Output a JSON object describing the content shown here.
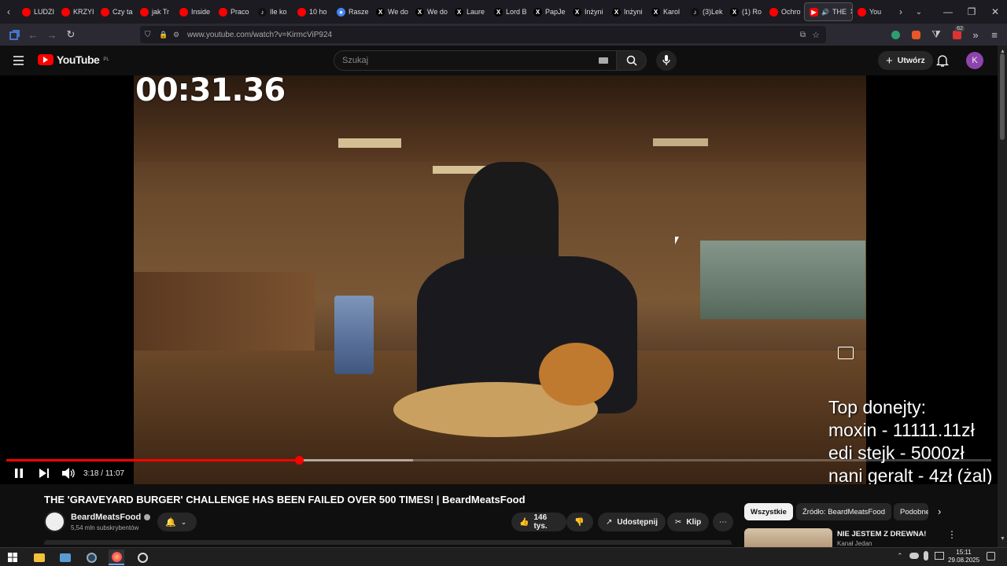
{
  "browser": {
    "tabs": [
      {
        "label": "LUDZI",
        "favicon": "youtube"
      },
      {
        "label": "KRZYI",
        "favicon": "youtube"
      },
      {
        "label": "Czy ta",
        "favicon": "youtube"
      },
      {
        "label": "jak Tr",
        "favicon": "youtube"
      },
      {
        "label": "Inside",
        "favicon": "youtube"
      },
      {
        "label": "Praco",
        "favicon": "youtube"
      },
      {
        "label": "Ile ko",
        "favicon": "tiktok"
      },
      {
        "label": "10 ho",
        "favicon": "youtube"
      },
      {
        "label": "Rasze",
        "favicon": "google"
      },
      {
        "label": "We do",
        "favicon": "x"
      },
      {
        "label": "We do",
        "favicon": "x"
      },
      {
        "label": "Laure",
        "favicon": "x"
      },
      {
        "label": "Lord B",
        "favicon": "x"
      },
      {
        "label": "PapJe",
        "favicon": "x"
      },
      {
        "label": "Inżyni",
        "favicon": "x"
      },
      {
        "label": "Inżyni",
        "favicon": "x"
      },
      {
        "label": "Karol",
        "favicon": "x"
      },
      {
        "label": "(3)Lek",
        "favicon": "tiktok"
      },
      {
        "label": "(1) Ro",
        "favicon": "x"
      },
      {
        "label": "Ochro",
        "favicon": "youtube"
      }
    ],
    "active_tab": {
      "label": "THE",
      "favicon": "youtube"
    },
    "next_tab": {
      "label": "You",
      "favicon": "youtube"
    },
    "url": "www.youtube.com/watch?v=KirmcViP924",
    "extension_badge": "62"
  },
  "youtube": {
    "logo_text": "YouTube",
    "region": "PL",
    "search_placeholder": "Szukaj",
    "create_label": "Utwórz",
    "avatar_letter": "K"
  },
  "player": {
    "overlay_timer": "00:31.36",
    "donors": [
      "Top donejty:",
      "moxin - 11111.11zł",
      "edi stejk - 5000zł",
      "nani geralt - 4zł (żal)"
    ],
    "time_current": "3:18",
    "time_separator": "/",
    "time_total": "11:07",
    "progress_fraction": 0.297,
    "buffered_fraction": 0.413
  },
  "video": {
    "title": "THE 'GRAVEYARD BURGER' CHALLENGE HAS BEEN FAILED OVER 500 TIMES! | BeardMeatsFood",
    "channel": "BeardMeatsFood",
    "subscribers": "5,54 mln subskrybentów",
    "likes": "146 tys.",
    "share_label": "Udostępnij",
    "clip_label": "Klip"
  },
  "sidebar": {
    "chips": [
      "Wszystkie",
      "Źródło: BeardMeatsFood",
      "Podobne"
    ],
    "first_video_title": "NIE JESTEM Z DREWNA!",
    "first_video_channel": "Kanał Jedan"
  },
  "taskbar": {
    "time": "15:11",
    "date": "29.08.2025"
  },
  "colors": {
    "youtube_red": "#ff0000",
    "avatar": "#8e44ad",
    "page_bg": "#0f0f0f"
  }
}
